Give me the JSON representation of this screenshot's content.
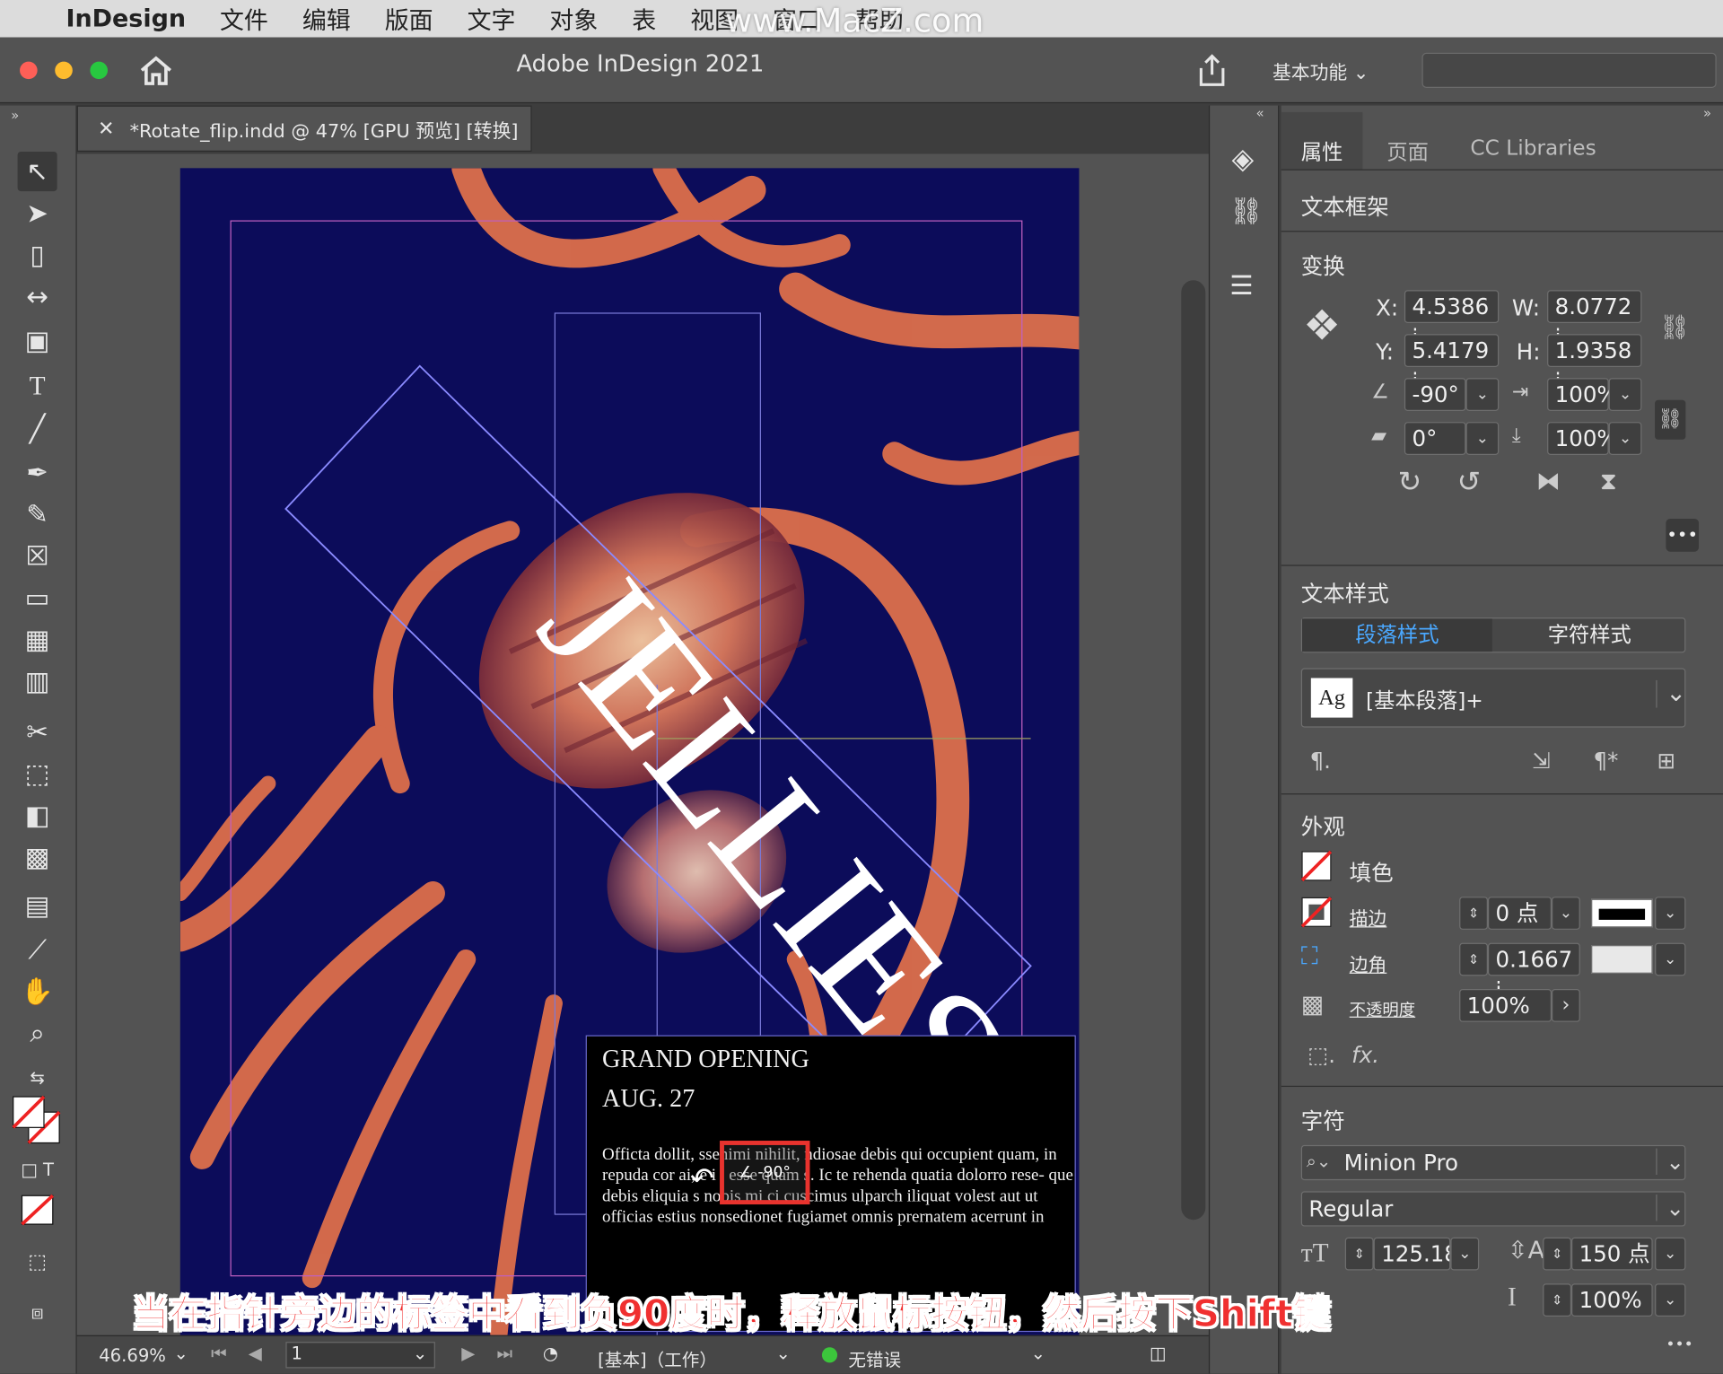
{
  "menubar": {
    "app": "InDesign",
    "items": [
      "文件",
      "编辑",
      "版面",
      "文字",
      "对象",
      "表",
      "视图",
      "窗口",
      "帮助"
    ],
    "watermark": "www.MacZ.com"
  },
  "window": {
    "title": "Adobe InDesign 2021",
    "workspace": "基本功能"
  },
  "document": {
    "tab_label": "*Rotate_flip.indd @ 47% [GPU 预览] [转换]",
    "jellies_text": "JELLIES",
    "grand_opening": "GRAND OPENING",
    "date": "AUG. 27",
    "body": "Officta dollit, ssenimi nihilit, ndiosae debis qui occupient quam, in repuda cor ai, e i , esse quam s. Ic te rehenda quatia dolorro rese- que debis eliquia s nobis mi ci cuscimus ulparch iliquat volest aut ut officias estius nonsedionet fugiamet omnis prernatem acerrunt in",
    "rotation_tooltip": "∠ -90°"
  },
  "panel": {
    "tabs": [
      "属性",
      "页面",
      "CC Libraries"
    ],
    "active_tab": "属性",
    "object_type": "文本框架",
    "transform": {
      "heading": "变换",
      "x_label": "X:",
      "x": "4.5386 i",
      "y_label": "Y:",
      "y": "5.4179 i",
      "w_label": "W:",
      "w": "8.0772 i",
      "h_label": "H:",
      "h": "1.9358 i",
      "rotation": "-90°",
      "shear": "0°",
      "scale_x": "100%",
      "scale_y": "100%"
    },
    "text_style": {
      "heading": "文本样式",
      "tab_para": "段落样式",
      "tab_char": "字符样式",
      "style_name": "[基本段落]+",
      "style_icon": "Ag"
    },
    "appearance": {
      "heading": "外观",
      "fill": "填色",
      "stroke": "描边",
      "stroke_value": "0 点",
      "corner": "边角",
      "corner_value": "0.1667 i",
      "opacity": "不透明度",
      "opacity_value": "100%"
    },
    "character": {
      "heading": "字符",
      "font": "Minion Pro",
      "style": "Regular",
      "size": "125.18",
      "leading": "150 点",
      "scale": "100%"
    }
  },
  "status": {
    "zoom": "46.69%",
    "page": "1",
    "style": "[基本]（工作）",
    "errors": "无错误"
  },
  "caption": "当在指针旁边的标签中看到负90度时，释放鼠标按钮，然后按下Shift键",
  "colors": {
    "accent": "#4aa8ff",
    "caption": "#f03030",
    "tooltip_border": "#e8332e",
    "page_bg": "#0c0c5a"
  }
}
